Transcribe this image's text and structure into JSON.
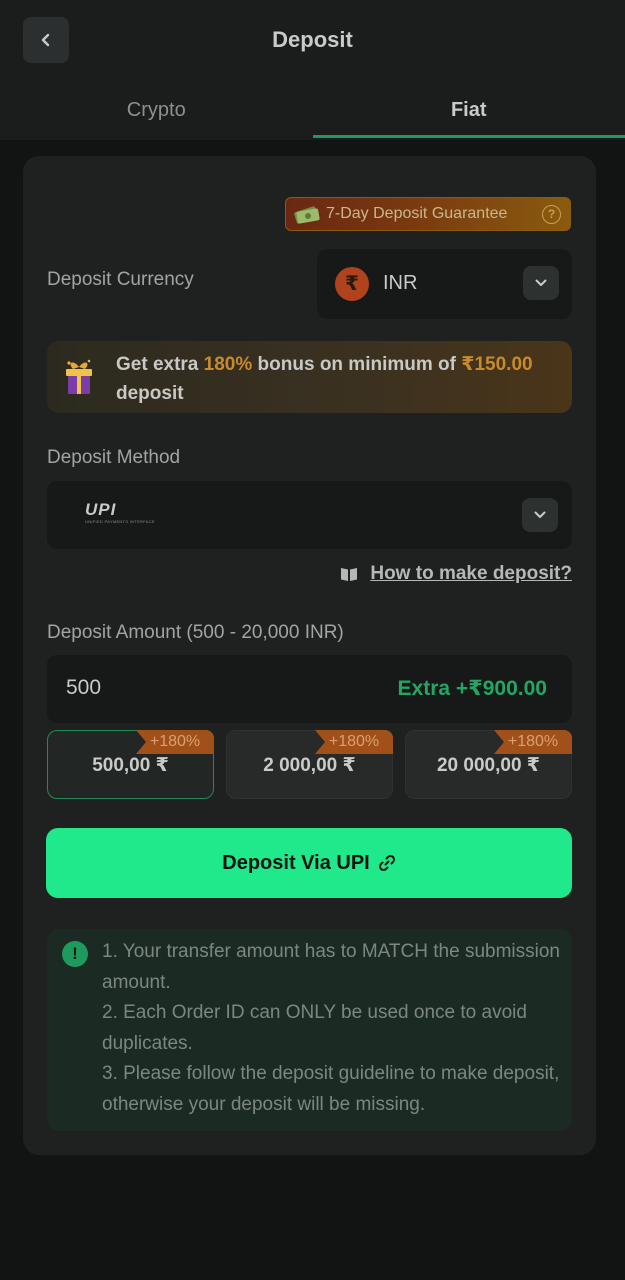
{
  "header": {
    "title": "Deposit",
    "back_icon": "chevron-left-icon"
  },
  "tabs": [
    {
      "label": "Crypto",
      "active": false
    },
    {
      "label": "Fiat",
      "active": true
    }
  ],
  "guarantee": {
    "label": "7-Day Deposit Guarantee",
    "help": "?"
  },
  "currency": {
    "label": "Deposit Currency",
    "symbol": "₹",
    "code": "INR"
  },
  "bonus": {
    "prefix": "Get extra ",
    "percent": "180%",
    "middle": " bonus on minimum of ",
    "minimum": "₹150.00",
    "suffix": " deposit"
  },
  "method": {
    "label": "Deposit Method",
    "selected_logo": "UPI",
    "selected_logo_sub": "UNIFIED PAYMENTS INTERFACE"
  },
  "how_link": "How to make deposit?",
  "amount": {
    "label": "Deposit Amount (500 - 20,000 INR)",
    "value": "500",
    "extra": "Extra +₹900.00"
  },
  "quick_amounts": [
    {
      "value": "500,00 ₹",
      "badge": "+180%",
      "selected": true
    },
    {
      "value": "2 000,00 ₹",
      "badge": "+180%",
      "selected": false
    },
    {
      "value": "20 000,00 ₹",
      "badge": "+180%",
      "selected": false
    }
  ],
  "deposit_button": "Deposit Via UPI",
  "notice": {
    "lines": [
      "1. Your transfer amount has to MATCH the submission amount.",
      "2. Each Order ID can ONLY be used once to avoid duplicates.",
      "3. Please follow the deposit guideline to make deposit, otherwise your deposit will be missing."
    ]
  },
  "colors": {
    "accent_green": "#1fe98a",
    "extra_green": "#22a565",
    "bonus_orange": "#c88a2e",
    "badge_orange": "#a2501a"
  }
}
